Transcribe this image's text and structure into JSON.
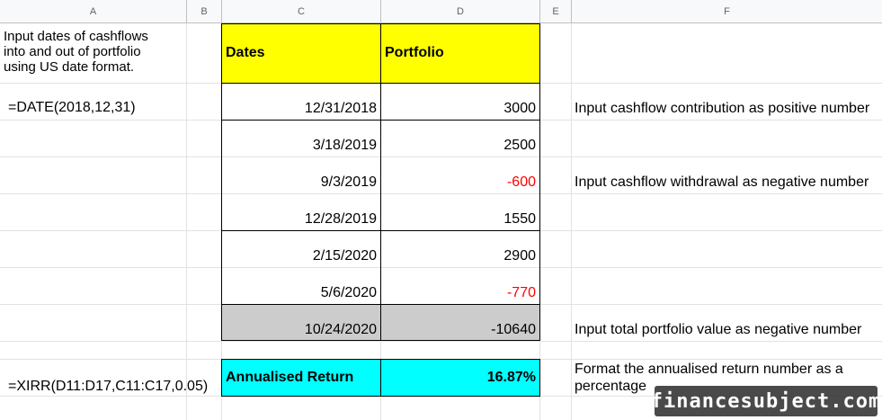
{
  "columns": [
    "A",
    "B",
    "C",
    "D",
    "E",
    "F"
  ],
  "cells": {
    "a_note_line1": "Input dates of cashflows",
    "a_note_line2": "into and out of portfolio",
    "a_note_line3": "using US date format.",
    "c_header": "Dates",
    "d_header": "Portfolio",
    "a_date_formula": "=DATE(2018,12,31)",
    "f_note_positive": "Input cashflow contribution as positive number",
    "f_note_negative": "Input cashflow withdrawal as negative number",
    "f_note_total": "Input total portfolio value as negative number",
    "a_xirr_formula": "=XIRR(D11:D17,C11:C17,0.05)",
    "c_result_label": "Annualised Return",
    "d_result_value": "16.87%",
    "f_note_format_line1": "Format the annualised return number as a",
    "f_note_format_line2": "percentage"
  },
  "rows": [
    {
      "date": "12/31/2018",
      "value": "3000",
      "negative": false
    },
    {
      "date": "3/18/2019",
      "value": "2500",
      "negative": false
    },
    {
      "date": "9/3/2019",
      "value": "-600",
      "negative": true
    },
    {
      "date": "12/28/2019",
      "value": "1550",
      "negative": false
    },
    {
      "date": "2/15/2020",
      "value": "2900",
      "negative": false
    },
    {
      "date": "5/6/2020",
      "value": "-770",
      "negative": true
    },
    {
      "date": "10/24/2020",
      "value": "-10640",
      "negative": false
    }
  ],
  "colors": {
    "yellow": "#ffff00",
    "cyan": "#00ffff",
    "gray": "#cccccc",
    "red": "#ff0000"
  },
  "watermark": "financesubject.com"
}
